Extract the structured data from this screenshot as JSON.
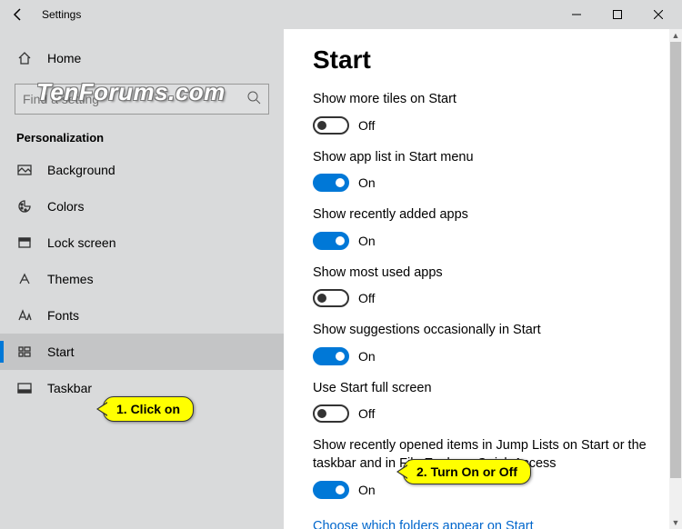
{
  "window": {
    "title": "Settings"
  },
  "watermark": "TenForums.com",
  "search": {
    "placeholder": "Find a setting"
  },
  "sidebar": {
    "home": "Home",
    "section": "Personalization",
    "items": [
      {
        "label": "Background"
      },
      {
        "label": "Colors"
      },
      {
        "label": "Lock screen"
      },
      {
        "label": "Themes"
      },
      {
        "label": "Fonts"
      },
      {
        "label": "Start"
      },
      {
        "label": "Taskbar"
      }
    ]
  },
  "page": {
    "heading": "Start",
    "settings": [
      {
        "label": "Show more tiles on Start",
        "on": false,
        "state": "Off"
      },
      {
        "label": "Show app list in Start menu",
        "on": true,
        "state": "On"
      },
      {
        "label": "Show recently added apps",
        "on": true,
        "state": "On"
      },
      {
        "label": "Show most used apps",
        "on": false,
        "state": "Off"
      },
      {
        "label": "Show suggestions occasionally in Start",
        "on": true,
        "state": "On"
      },
      {
        "label": "Use Start full screen",
        "on": false,
        "state": "Off"
      },
      {
        "label": "Show recently opened items in Jump Lists on Start or the taskbar and in File Explorer Quick Access",
        "on": true,
        "state": "On"
      }
    ],
    "link": "Choose which folders appear on Start"
  },
  "callouts": {
    "c1": "1. Click on",
    "c2": "2. Turn On or Off"
  }
}
